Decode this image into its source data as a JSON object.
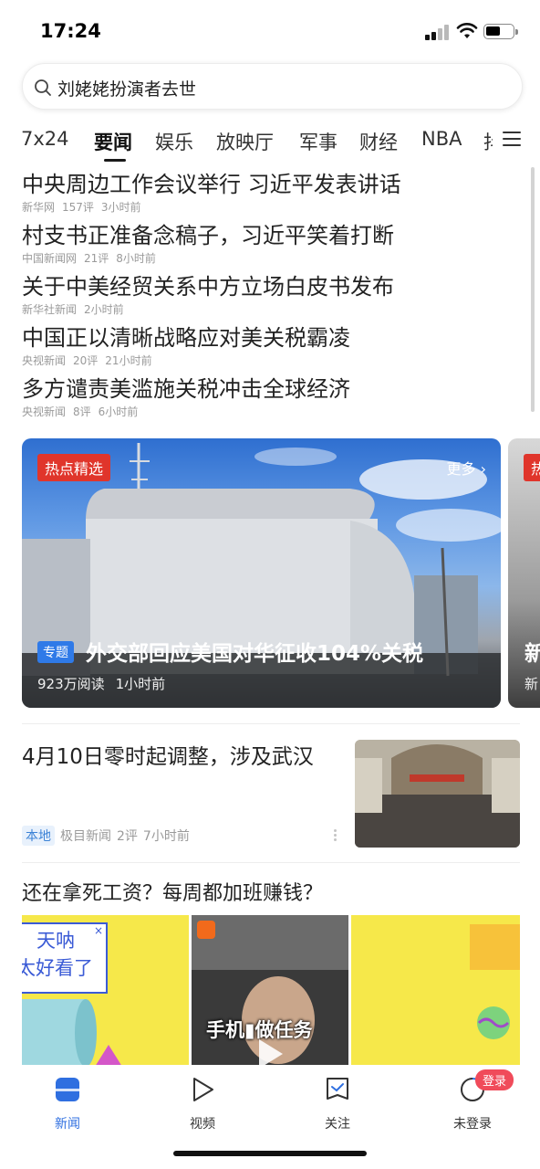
{
  "status_bar": {
    "time": "17:24",
    "signal_bars_on": 2,
    "signal_bars_total": 4
  },
  "search": {
    "query": "刘姥姥扮演者去世",
    "icon": "search-icon"
  },
  "tabs": [
    {
      "label": "7x24",
      "active": false
    },
    {
      "label": "要闻",
      "active": true
    },
    {
      "label": "娱乐",
      "active": false
    },
    {
      "label": "放映厅",
      "active": false
    },
    {
      "label": "军事",
      "active": false
    },
    {
      "label": "财经",
      "active": false
    },
    {
      "label": "NBA",
      "active": false
    },
    {
      "label": "抖",
      "active": false
    }
  ],
  "headlines": [
    {
      "title": "中央周边工作会议举行 习近平发表讲话",
      "source": "新华网",
      "comments": "157评",
      "time": "3小时前"
    },
    {
      "title": "村支书正准备念稿子，习近平笑着打断",
      "source": "中国新闻网",
      "comments": "21评",
      "time": "8小时前"
    },
    {
      "title": "关于中美经贸关系中方立场白皮书发布",
      "source": "新华社新闻",
      "comments": "",
      "time": "2小时前"
    },
    {
      "title": "中国正以清晰战略应对美关税霸凌",
      "source": "央视新闻",
      "comments": "20评",
      "time": "21小时前"
    },
    {
      "title": "多方谴责美滥施关税冲击全球经济",
      "source": "央视新闻",
      "comments": "8评",
      "time": "6小时前"
    }
  ],
  "topic_card": {
    "tag": "热点精选",
    "more": "更多 ›",
    "badge": "专题",
    "title": "外交部回应美国对华征收104%关税",
    "reads": "923万阅读",
    "time": "1小时前"
  },
  "topic_card_next": {
    "tag": "热",
    "title": "新",
    "meta": "新"
  },
  "article": {
    "title": "4月10日零时起调整，涉及武汉",
    "badge": "本地",
    "source": "极目新闻",
    "comments": "2评",
    "time": "7小时前"
  },
  "promo": {
    "title": "还在拿死工资？每周都加班赚钱？",
    "bubble_line1": "天呐",
    "bubble_line2": "太好看了",
    "bubble_close": "×",
    "overlay_text": "手机▮做任务"
  },
  "bottom_nav": [
    {
      "label": "新闻",
      "icon": "news-icon",
      "active": true
    },
    {
      "label": "视频",
      "icon": "video-icon",
      "active": false
    },
    {
      "label": "关注",
      "icon": "follow-icon",
      "active": false
    },
    {
      "label": "未登录",
      "icon": "user-icon",
      "active": false
    }
  ],
  "login_badge": "登录",
  "colors": {
    "accent": "#2f6fe0",
    "tag_red": "#e0352b",
    "badge_blue": "#2f7ae8"
  }
}
